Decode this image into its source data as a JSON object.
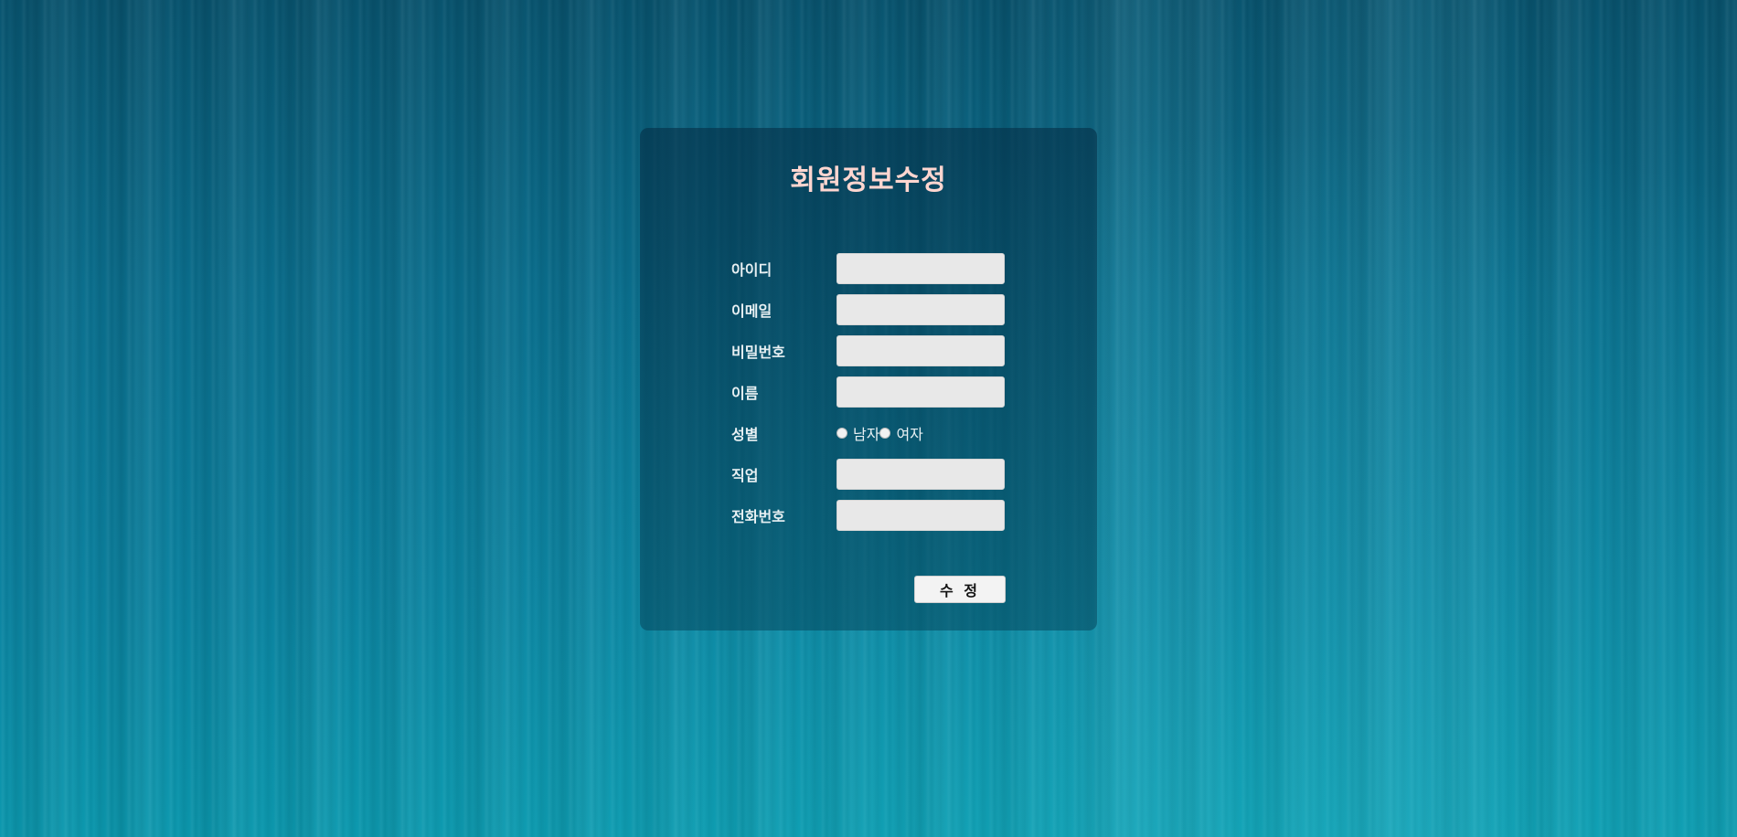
{
  "form": {
    "title": "회원정보수정",
    "fields": {
      "id": {
        "label": "아이디",
        "value": ""
      },
      "email": {
        "label": "이메일",
        "value": ""
      },
      "password": {
        "label": "비밀번호",
        "value": ""
      },
      "name": {
        "label": "이름",
        "value": ""
      },
      "job": {
        "label": "직업",
        "value": ""
      },
      "phone": {
        "label": "전화번호",
        "value": ""
      }
    },
    "gender": {
      "label": "성별",
      "options": [
        "남자",
        "여자"
      ]
    },
    "submit_label": "수 정"
  }
}
